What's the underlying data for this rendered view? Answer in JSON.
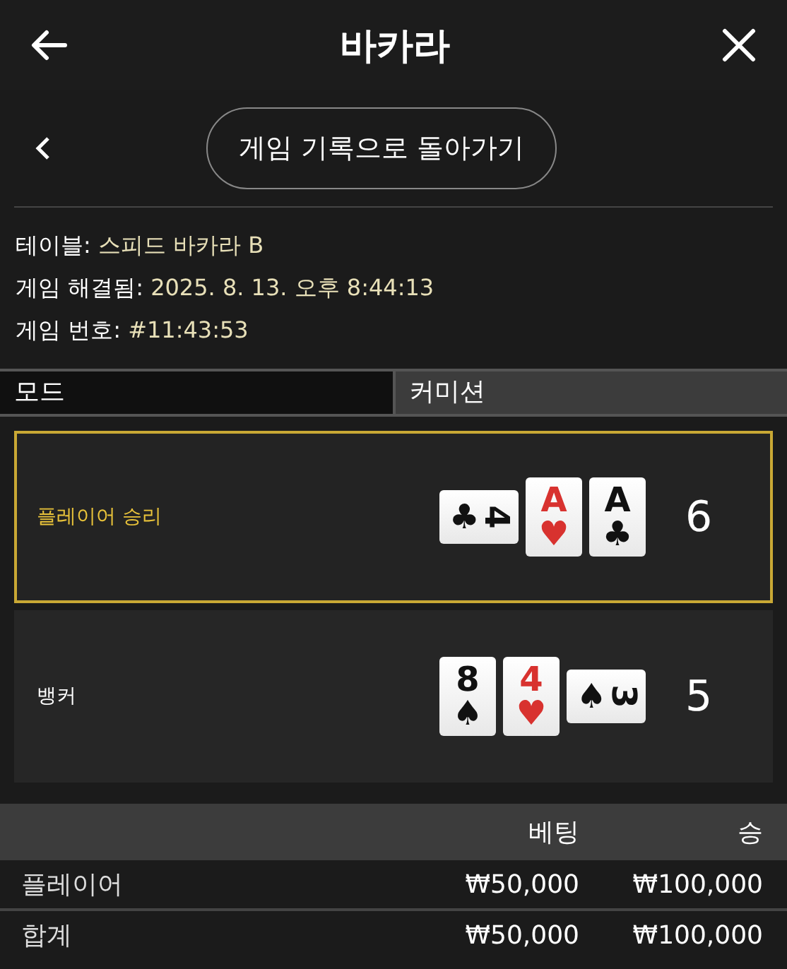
{
  "header": {
    "title": "바카라"
  },
  "back_row": {
    "button": "게임 기록으로 돌아가기"
  },
  "info": [
    {
      "label": "테이블:",
      "value": "스피드 바카라 B"
    },
    {
      "label": "게임 해결됨:",
      "value": "2025. 8. 13. 오후 8:44:13"
    },
    {
      "label": "게임 번호:",
      "value": "#11:43:53"
    }
  ],
  "tabs": [
    {
      "label": "모드",
      "selected": true
    },
    {
      "label": "커미션",
      "selected": false
    }
  ],
  "hands": [
    {
      "label": "플레이어 승리",
      "winner": true,
      "score": "6",
      "cards": [
        {
          "rank": "4",
          "suit": "♣",
          "color": "#111111",
          "sideways": true
        },
        {
          "rank": "A",
          "suit": "♥",
          "color": "#d8322f",
          "sideways": false
        },
        {
          "rank": "A",
          "suit": "♣",
          "color": "#111111",
          "sideways": false
        }
      ]
    },
    {
      "label": "뱅커",
      "winner": false,
      "score": "5",
      "cards": [
        {
          "rank": "8",
          "suit": "♠",
          "color": "#111111",
          "sideways": false
        },
        {
          "rank": "4",
          "suit": "♥",
          "color": "#d8322f",
          "sideways": false
        },
        {
          "rank": "3",
          "suit": "♠",
          "color": "#111111",
          "sideways": true
        }
      ]
    }
  ],
  "bets": {
    "columns": [
      "베팅",
      "승"
    ],
    "rows": [
      {
        "label": "플레이어",
        "bet": "₩50,000",
        "win": "₩100,000"
      },
      {
        "label": "합계",
        "bet": "₩50,000",
        "win": "₩100,000"
      }
    ]
  }
}
